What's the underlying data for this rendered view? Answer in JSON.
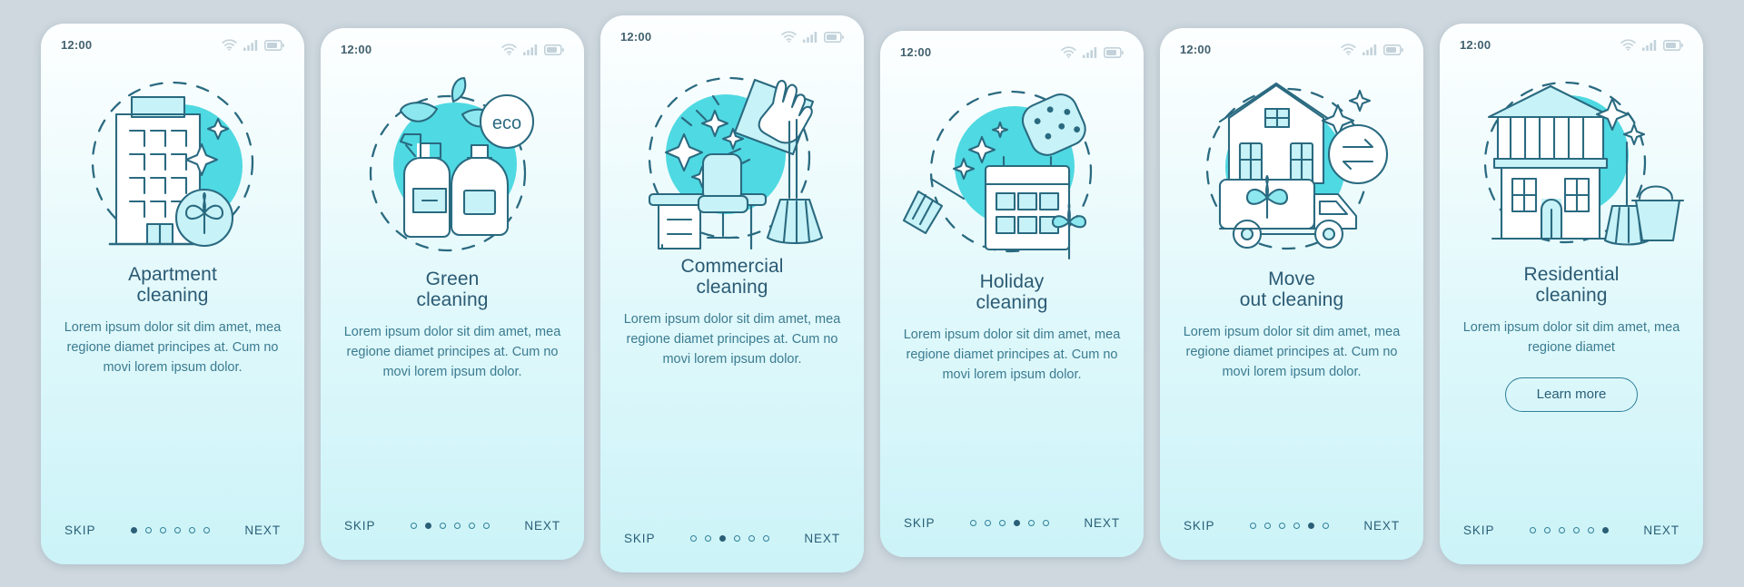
{
  "app": {
    "kind": "onboarding-carousel",
    "screen_count": 6,
    "accent": "#4fd9e2",
    "ink": "#2a6a80",
    "title_color": "#2a5a73",
    "body_color": "#3b7b90",
    "page_background": "#cfd8df",
    "card_gradient_top": "#fdffff",
    "card_gradient_bottom": "#cbf3f8"
  },
  "status_bar": {
    "time": "12:00",
    "icons": [
      "wifi-icon",
      "cellular-signal-icon",
      "battery-icon"
    ]
  },
  "nav": {
    "skip_label": "SKIP",
    "next_label": "NEXT"
  },
  "screens": [
    {
      "id": "apartment-cleaning",
      "title_line1": "Apartment",
      "title_line2": "cleaning",
      "body": "Lorem ipsum dolor sit dim amet, mea regione diamet principes at. Cum no movi lorem ipsum dolor.",
      "illustration": "apartment-building-with-duster-icon",
      "active_dot": 1,
      "has_learn_more": false
    },
    {
      "id": "green-cleaning",
      "title_line1": "Green",
      "title_line2": "cleaning",
      "body": "Lorem ipsum dolor sit dim amet, mea regione diamet principes at. Cum no movi lorem ipsum dolor.",
      "illustration": "eco-spray-bottles-with-leaves-icon",
      "badge_text": "eco",
      "active_dot": 2,
      "has_learn_more": false
    },
    {
      "id": "commercial-cleaning",
      "title_line1": "Commercial",
      "title_line2": "cleaning",
      "body": "Lorem ipsum dolor sit dim amet, mea regione diamet principes at. Cum no movi lorem ipsum dolor.",
      "illustration": "office-desk-with-mop-and-gloved-hand-icon",
      "active_dot": 3,
      "has_learn_more": false
    },
    {
      "id": "holiday-cleaning",
      "title_line1": "Holiday",
      "title_line2": "cleaning",
      "body": "Lorem ipsum dolor sit dim amet, mea regione diamet principes at. Cum no movi lorem ipsum dolor.",
      "illustration": "calendar-with-broom-and-sponge-icon",
      "active_dot": 4,
      "has_learn_more": false
    },
    {
      "id": "move-out-cleaning",
      "title_line1": "Move",
      "title_line2": "out cleaning",
      "body": "Lorem ipsum dolor sit dim amet, mea regione diamet principes at. Cum no movi lorem ipsum dolor.",
      "illustration": "house-with-moving-truck-and-exchange-arrows-icon",
      "active_dot": 5,
      "has_learn_more": false
    },
    {
      "id": "residential-cleaning",
      "title_line1": "Residential",
      "title_line2": "cleaning",
      "body": "Lorem ipsum dolor sit dim amet, mea regione diamet",
      "illustration": "two-story-house-with-broom-and-bucket-icon",
      "active_dot": 6,
      "has_learn_more": true,
      "learn_more_label": "Learn more"
    }
  ]
}
